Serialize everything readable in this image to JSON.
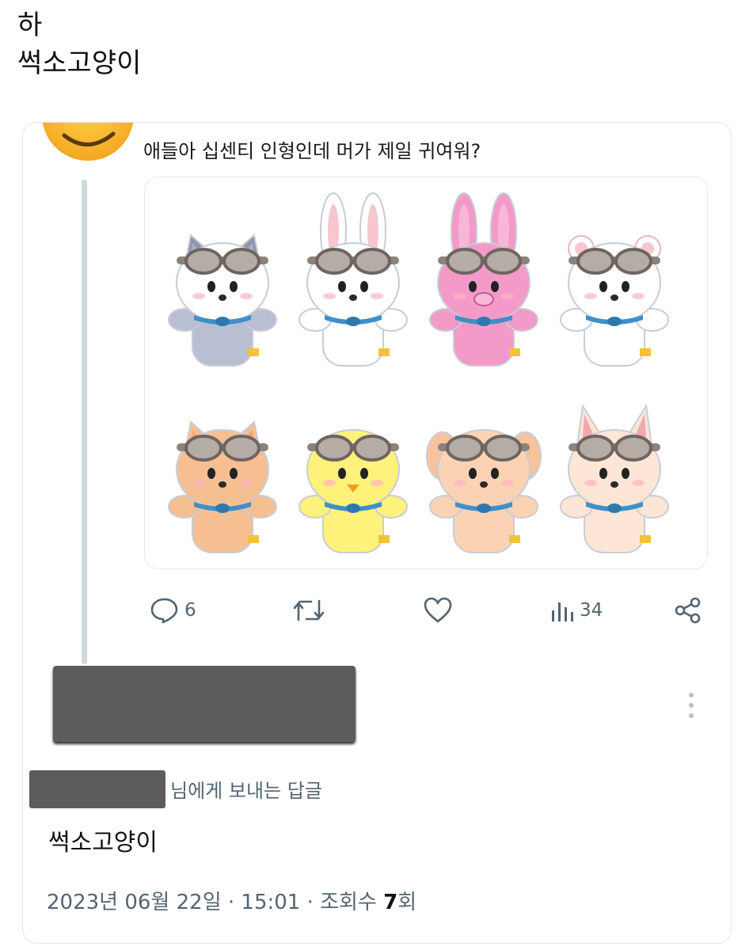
{
  "caption": {
    "line1": "하",
    "line2": "썩소고양이"
  },
  "tweet": {
    "text": "애들아 십센티 인형인데 머가 제일 귀여워?",
    "plushies": [
      {
        "name": "gray-wolf",
        "body": "#b9bfd3",
        "face": "#ffffff",
        "ear": "#8e96ad",
        "inner": "#a9b1c6",
        "type": "pointy"
      },
      {
        "name": "white-rabbit",
        "body": "#ffffff",
        "face": "#ffffff",
        "ear": "#ffffff",
        "inner": "#f6c7cf",
        "type": "long"
      },
      {
        "name": "pink-rabbit",
        "body": "#f49ac8",
        "face": "#f49ac8",
        "ear": "#f49ac8",
        "inner": "#f7b8d8",
        "type": "long"
      },
      {
        "name": "white-cat",
        "body": "#ffffff",
        "face": "#ffffff",
        "ear": "#ffffff",
        "inner": "#f6c7cf",
        "type": "round"
      },
      {
        "name": "orange-quokka",
        "body": "#f6bf92",
        "face": "#f6bf92",
        "ear": "#f6bf92",
        "inner": "#f0a878",
        "type": "pointy"
      },
      {
        "name": "yellow-chick",
        "body": "#fff27a",
        "face": "#fff27a",
        "ear": "#fff27a",
        "inner": "#fff27a",
        "type": "none"
      },
      {
        "name": "peach-puppy",
        "body": "#fbd3b4",
        "face": "#fbd3b4",
        "ear": "#f7c39c",
        "inner": "#f7c39c",
        "type": "floppy"
      },
      {
        "name": "fox",
        "body": "#fde6d6",
        "face": "#fde6d6",
        "ear": "#fde6d6",
        "inner": "#f3a8b0",
        "type": "big"
      }
    ]
  },
  "actions": {
    "reply_count": "6",
    "view_count": "34"
  },
  "reply": {
    "to_label": "님에게 보내는 답글",
    "text": "썩소고양이"
  },
  "meta": {
    "datetime": "2023년 06월 22일 · 15:01 · 조회수 ",
    "views": "7",
    "views_suffix": "회"
  },
  "colors": {
    "muted": "#536471",
    "line": "#cfd9de",
    "redact": "#5c5c5e"
  }
}
